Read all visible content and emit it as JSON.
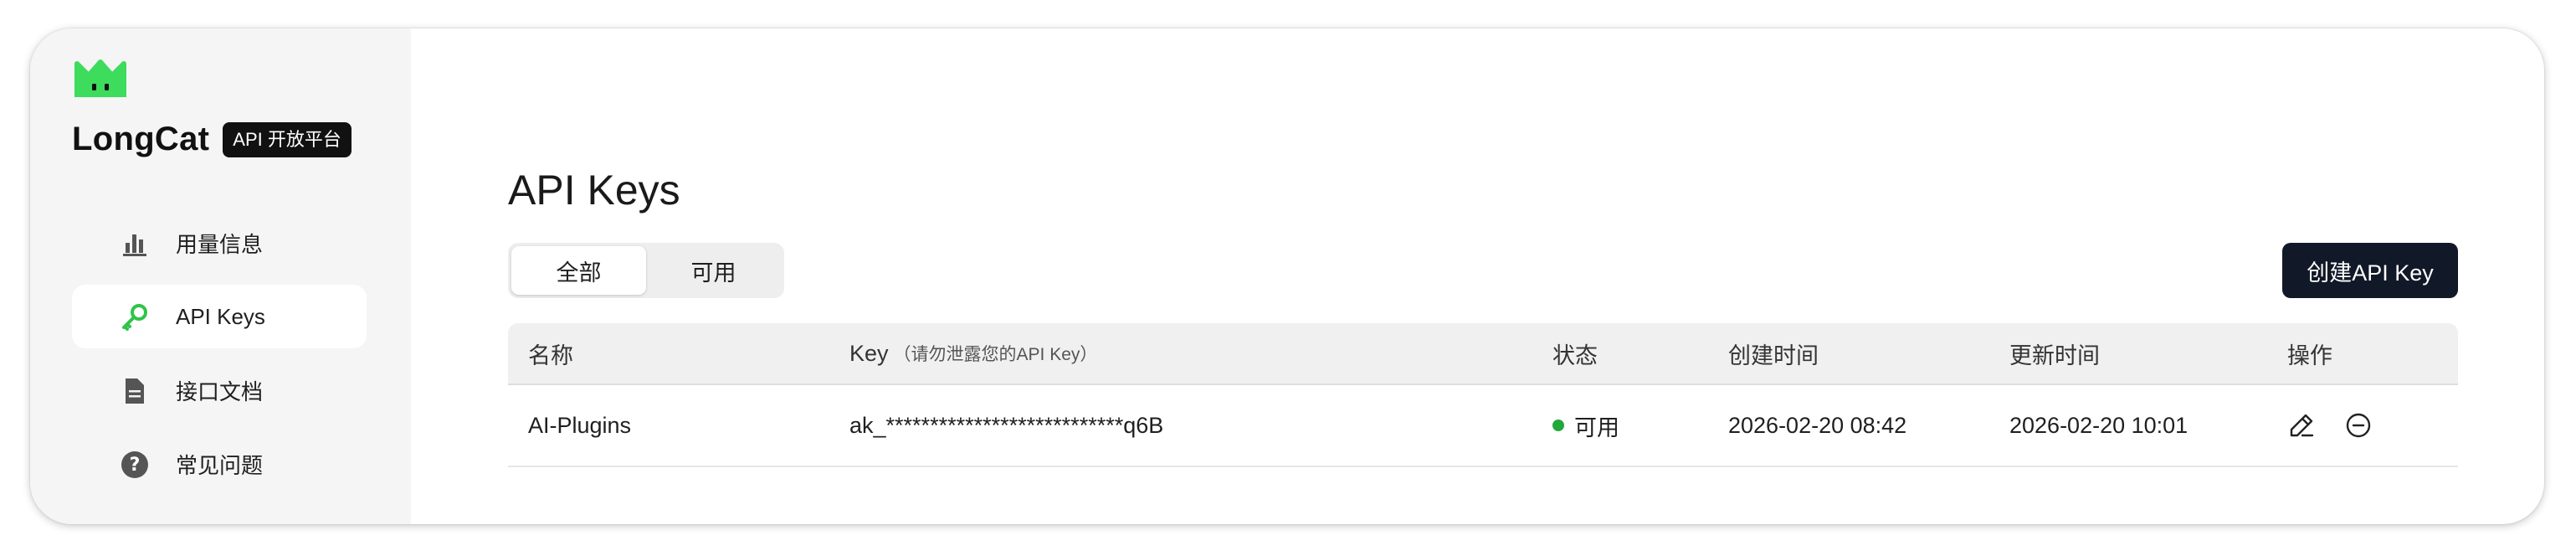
{
  "brand": {
    "name": "LongCat",
    "badge": "API 开放平台",
    "accent": "#3ddc5c"
  },
  "sidebar": {
    "items": [
      {
        "label": "用量信息",
        "icon": "bar-chart-icon",
        "active": false
      },
      {
        "label": "API Keys",
        "icon": "key-icon",
        "active": true
      },
      {
        "label": "接口文档",
        "icon": "document-icon",
        "active": false
      },
      {
        "label": "常见问题",
        "icon": "help-circle-icon",
        "active": false
      }
    ]
  },
  "main": {
    "title": "API Keys",
    "filter": {
      "tabs": [
        "全部",
        "可用"
      ],
      "selected": "全部"
    },
    "create_button": "创建API Key",
    "table": {
      "headers": {
        "name": "名称",
        "key": "Key",
        "key_note": "（请勿泄露您的API Key）",
        "status": "状态",
        "created": "创建时间",
        "updated": "更新时间",
        "actions": "操作"
      },
      "rows": [
        {
          "name": "AI-Plugins",
          "key": "ak_***************************q6B",
          "status": "可用",
          "status_color": "#22a83a",
          "created": "2026-02-20 08:42",
          "updated": "2026-02-20 10:01",
          "actions": [
            "edit-icon",
            "disable-icon"
          ]
        }
      ]
    }
  }
}
